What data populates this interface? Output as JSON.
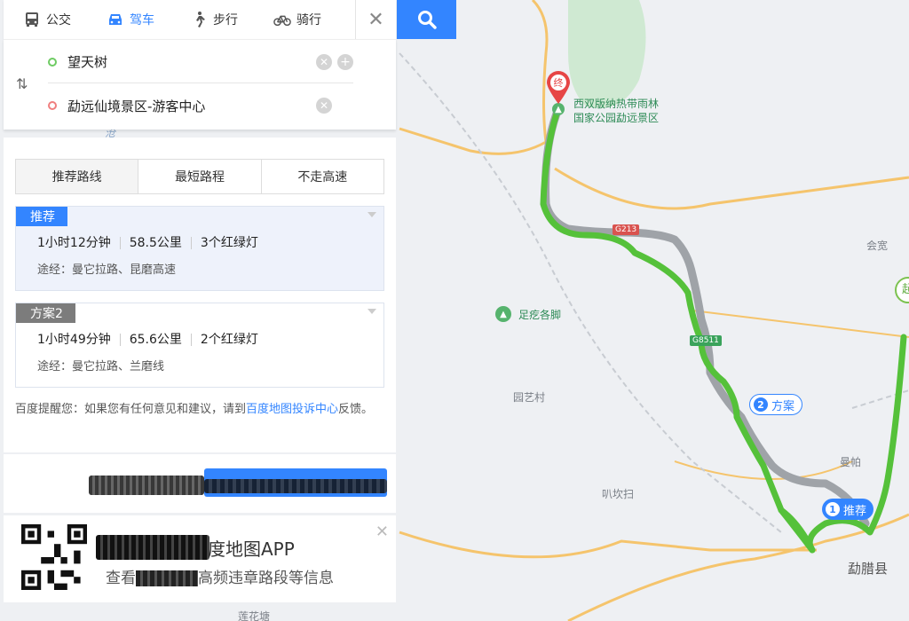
{
  "transport_tabs": [
    {
      "label": "公交",
      "icon": "bus-icon"
    },
    {
      "label": "驾车",
      "icon": "car-icon"
    },
    {
      "label": "步行",
      "icon": "walk-icon"
    },
    {
      "label": "骑行",
      "icon": "bike-icon"
    }
  ],
  "active_tab": "驾车",
  "accent_color": "#3385ff",
  "route": {
    "start": "望天树",
    "end": "勐远仙境景区-游客中心"
  },
  "route_options": [
    "推荐路线",
    "最短路程",
    "不走高速"
  ],
  "plans": [
    {
      "tag": "推荐",
      "time": "1小时12分钟",
      "distance": "58.5公里",
      "lights": "3个红绿灯",
      "via": "途经：曼它拉路、昆磨高速"
    },
    {
      "tag": "方案2",
      "time": "1小时49分钟",
      "distance": "65.6公里",
      "lights": "2个红绿灯",
      "via": "途经：曼它拉路、兰磨线"
    }
  ],
  "notice": {
    "before": "百度提醒您：如果您有任何意见和建议，请到",
    "link": "百度地图投诉中心",
    "after": "反馈。"
  },
  "promo": {
    "title": "度地图APP",
    "subtitle": "查看",
    "subtitle_tail": "高频违章路段等信息"
  },
  "map": {
    "labels": [
      "会宽",
      "园艺村",
      "叭坎扫",
      "曼帕",
      "勐腊县",
      "莲花塘",
      "沧"
    ],
    "poi_end_name_line1": "西双版纳热带雨林",
    "poi_end_name_line2": "国家公园勐远景区",
    "poi_other": "足疙各脚",
    "end_pin": "终",
    "roads": [
      "G213",
      "G8511"
    ],
    "badge_main": {
      "num": "1",
      "label": "推荐"
    },
    "badge_alt": {
      "num": "2",
      "label": "方案"
    },
    "partial_marker": "起"
  }
}
